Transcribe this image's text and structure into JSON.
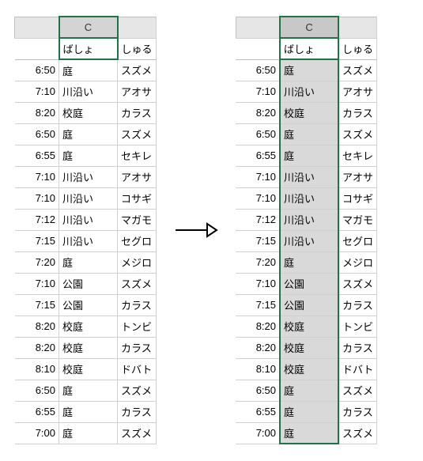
{
  "column_letter": "C",
  "headers": {
    "place": "ばしょ",
    "type": "しゅる"
  },
  "rows": [
    {
      "time": "6:50",
      "place": "庭",
      "type": "スズメ"
    },
    {
      "time": "7:10",
      "place": "川沿い",
      "type": "アオサ"
    },
    {
      "time": "8:20",
      "place": "校庭",
      "type": "カラス"
    },
    {
      "time": "6:50",
      "place": "庭",
      "type": "スズメ"
    },
    {
      "time": "6:55",
      "place": "庭",
      "type": "セキレ"
    },
    {
      "time": "7:10",
      "place": "川沿い",
      "type": "アオサ"
    },
    {
      "time": "7:10",
      "place": "川沿い",
      "type": "コサギ"
    },
    {
      "time": "7:12",
      "place": "川沿い",
      "type": "マガモ"
    },
    {
      "time": "7:15",
      "place": "川沿い",
      "type": "セグロ"
    },
    {
      "time": "7:20",
      "place": "庭",
      "type": "メジロ"
    },
    {
      "time": "7:10",
      "place": "公園",
      "type": "スズメ"
    },
    {
      "time": "7:15",
      "place": "公園",
      "type": "カラス"
    },
    {
      "time": "8:20",
      "place": "校庭",
      "type": "トンビ"
    },
    {
      "time": "8:20",
      "place": "校庭",
      "type": "カラス"
    },
    {
      "time": "8:10",
      "place": "校庭",
      "type": "ドバト"
    },
    {
      "time": "6:50",
      "place": "庭",
      "type": "スズメ"
    },
    {
      "time": "6:55",
      "place": "庭",
      "type": "カラス"
    },
    {
      "time": "7:00",
      "place": "庭",
      "type": "スズメ"
    }
  ],
  "right_rows_type_trunc": [
    "スズメ",
    "アオサ",
    "カラス",
    "スズメ",
    "セキレ",
    "アオサ",
    "コサギ",
    "マガモ",
    "セグロ",
    "メジロ",
    "スズメ",
    "カラス",
    "トンビ",
    "カラス",
    "ドバト",
    "スズメ",
    "カラス",
    "スズメ"
  ]
}
